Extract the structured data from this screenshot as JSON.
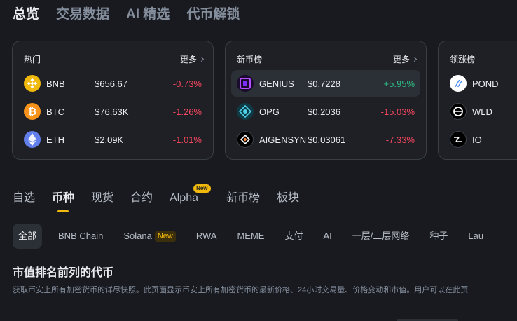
{
  "top_tabs": [
    "总览",
    "交易数据",
    "AI 精选",
    "代币解锁"
  ],
  "cards": {
    "hot": {
      "title": "热门",
      "more": "更多",
      "rows": [
        {
          "symbol": "BNB",
          "price": "$656.67",
          "change": "-0.73%",
          "icon": "bnb-icon"
        },
        {
          "symbol": "BTC",
          "price": "$76.63K",
          "change": "-1.26%",
          "icon": "btc-icon"
        },
        {
          "symbol": "ETH",
          "price": "$2.09K",
          "change": "-1.01%",
          "icon": "eth-icon"
        }
      ]
    },
    "new": {
      "title": "新币榜",
      "more": "更多",
      "rows": [
        {
          "symbol": "GENIUS",
          "price": "$0.7228",
          "change": "+5.95%",
          "icon": "genius-icon"
        },
        {
          "symbol": "OPG",
          "price": "$0.2036",
          "change": "-15.03%",
          "icon": "opg-icon"
        },
        {
          "symbol": "AIGENSYN",
          "price": "$0.03061",
          "change": "-7.33%",
          "icon": "aigensyn-icon"
        }
      ]
    },
    "gainers": {
      "title": "领涨榜",
      "rows": [
        {
          "symbol": "POND",
          "icon": "pond-icon"
        },
        {
          "symbol": "WLD",
          "icon": "wld-icon"
        },
        {
          "symbol": "IO",
          "icon": "io-icon"
        }
      ]
    }
  },
  "market_tabs": [
    {
      "label": "自选"
    },
    {
      "label": "币种",
      "active": true
    },
    {
      "label": "现货"
    },
    {
      "label": "合约"
    },
    {
      "label": "Alpha",
      "badge": "New"
    },
    {
      "label": "新币榜"
    },
    {
      "label": "板块"
    }
  ],
  "chips": [
    {
      "label": "全部",
      "active": true
    },
    {
      "label": "BNB Chain"
    },
    {
      "label": "Solana",
      "badge": "New"
    },
    {
      "label": "RWA"
    },
    {
      "label": "MEME"
    },
    {
      "label": "支付"
    },
    {
      "label": "AI"
    },
    {
      "label": "一层/二层网络"
    },
    {
      "label": "种子"
    },
    {
      "label": "Lau"
    }
  ],
  "section": {
    "title": "市值排名前列的代币",
    "desc": "获取币安上所有加密货币的详尽快照。此页面显示币安上所有加密货币的最新价格、24小时交易量、价格变动和市值。用户可以在此页"
  },
  "colors": {
    "accent": "#f0b90b",
    "down": "#f6465d",
    "up": "#2ebd85",
    "bg": "#181a20"
  }
}
